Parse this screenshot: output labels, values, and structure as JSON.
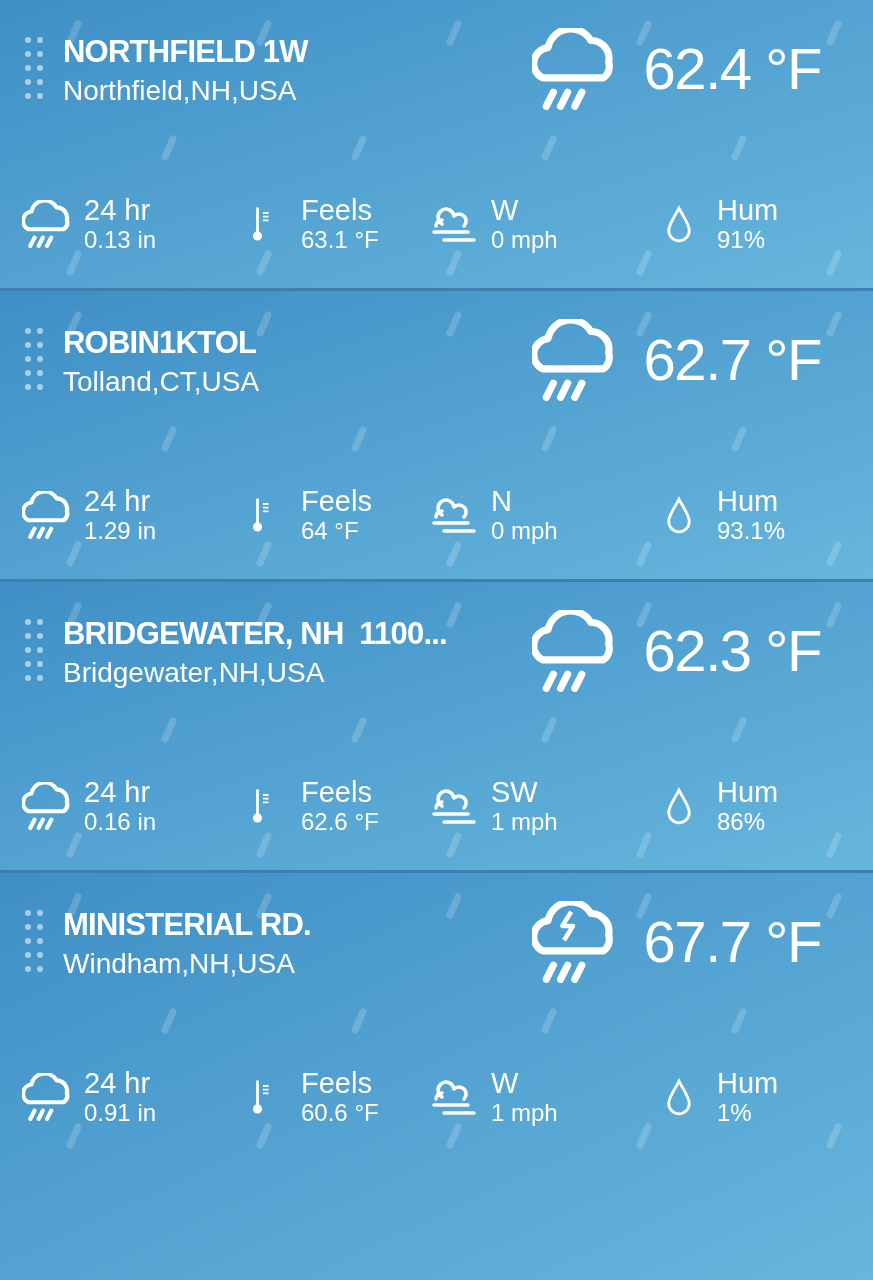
{
  "stations": [
    {
      "name": "NORTHFIELD 1W",
      "location": "Northfield,NH,USA",
      "kind": "rain",
      "temperature": "62.4 °F",
      "stats": [
        {
          "kind": "rain",
          "label": "24 hr",
          "value": "0.13 in"
        },
        {
          "kind": "feels",
          "label": "Feels",
          "value": "63.1 °F"
        },
        {
          "kind": "wind",
          "label": "W",
          "value": "0 mph"
        },
        {
          "kind": "humidity",
          "label": "Hum",
          "value": "91%"
        }
      ]
    },
    {
      "name": "ROBIN1KTOL",
      "location": "Tolland,CT,USA",
      "kind": "rain",
      "temperature": "62.7 °F",
      "stats": [
        {
          "kind": "rain",
          "label": "24 hr",
          "value": "1.29 in"
        },
        {
          "kind": "feels",
          "label": "Feels",
          "value": "64 °F"
        },
        {
          "kind": "wind",
          "label": "N",
          "value": "0 mph"
        },
        {
          "kind": "humidity",
          "label": "Hum",
          "value": "93.1%"
        }
      ]
    },
    {
      "name": "BRIDGEWATER, NH  1100...",
      "location": "Bridgewater,NH,USA",
      "kind": "rain",
      "temperature": "62.3 °F",
      "stats": [
        {
          "kind": "rain",
          "label": "24 hr",
          "value": "0.16 in"
        },
        {
          "kind": "feels",
          "label": "Feels",
          "value": "62.6 °F"
        },
        {
          "kind": "wind",
          "label": "SW",
          "value": "1 mph"
        },
        {
          "kind": "humidity",
          "label": "Hum",
          "value": "86%"
        }
      ]
    },
    {
      "name": "MINISTERIAL RD.",
      "location": "Windham,NH,USA",
      "kind": "thunder",
      "temperature": "67.7 °F",
      "stats": [
        {
          "kind": "rain",
          "label": "24 hr",
          "value": "0.91 in"
        },
        {
          "kind": "feels",
          "label": "Feels",
          "value": "60.6 °F"
        },
        {
          "kind": "wind",
          "label": "W",
          "value": "1 mph"
        },
        {
          "kind": "humidity",
          "label": "Hum",
          "value": "1%"
        }
      ]
    }
  ]
}
